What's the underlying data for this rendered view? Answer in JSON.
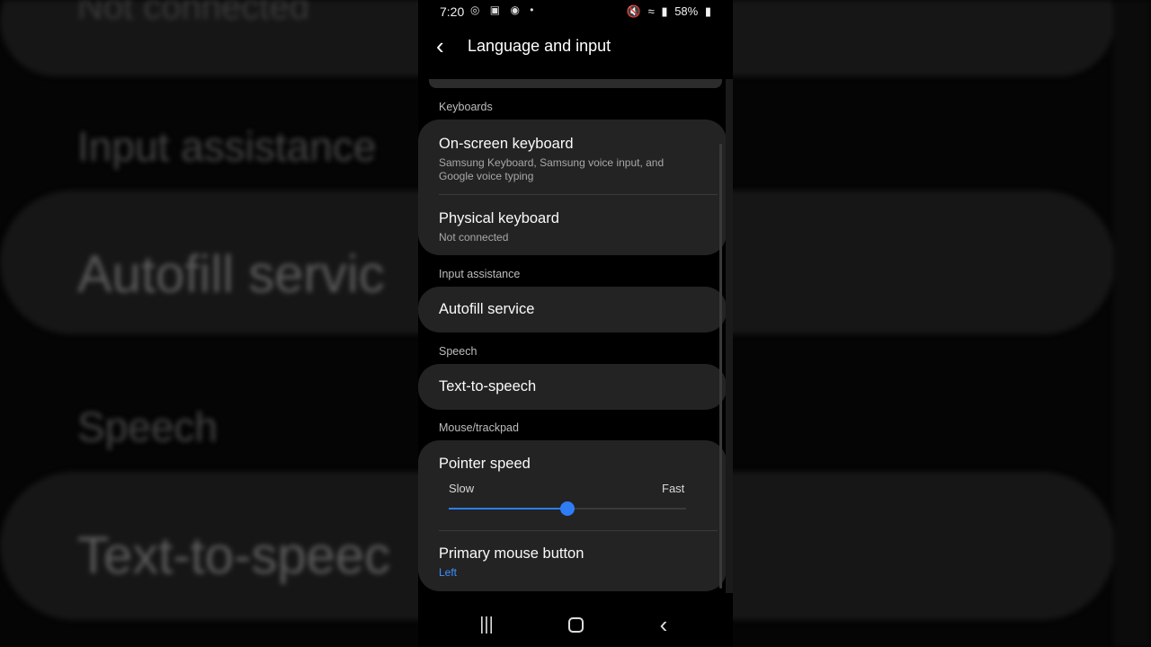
{
  "status": {
    "time": "7:20",
    "battery": "58%"
  },
  "header": {
    "title": "Language and input"
  },
  "sections": {
    "keyboards": "Keyboards",
    "input_assistance": "Input assistance",
    "speech": "Speech",
    "mouse_trackpad": "Mouse/trackpad"
  },
  "items": {
    "on_screen_keyboard": {
      "title": "On-screen keyboard",
      "summary": "Samsung Keyboard, Samsung voice input, and Google voice typing"
    },
    "physical_keyboard": {
      "title": "Physical keyboard",
      "summary": "Not connected"
    },
    "autofill": {
      "title": "Autofill service"
    },
    "tts": {
      "title": "Text-to-speech"
    },
    "pointer_speed": {
      "title": "Pointer speed",
      "slow_label": "Slow",
      "fast_label": "Fast",
      "value_fraction": 0.5
    },
    "primary_mouse": {
      "title": "Primary mouse button",
      "summary": "Left"
    }
  },
  "background": {
    "line1": "Not connected",
    "line2": "Input assistance",
    "line3": "Autofill servic",
    "line4": "Speech",
    "line5": "Text-to-speec"
  },
  "colors": {
    "accent": "#2f7df6",
    "card": "#232323"
  }
}
